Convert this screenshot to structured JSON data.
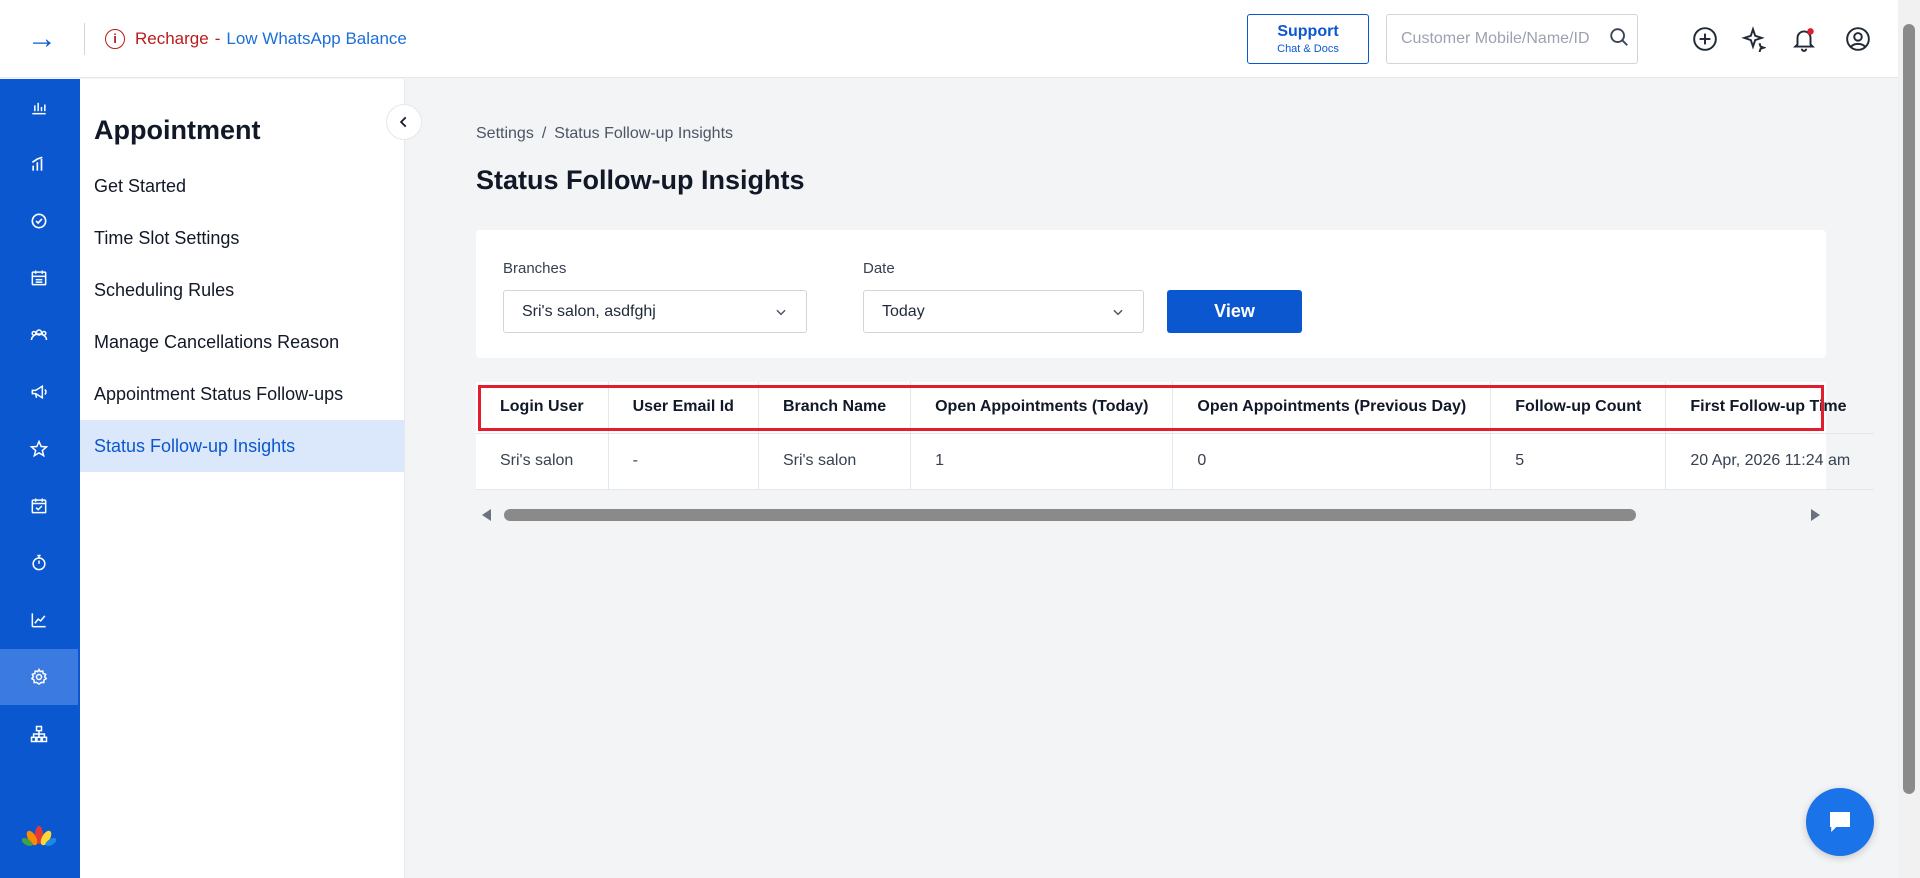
{
  "header": {
    "alert_recharge": "Recharge",
    "alert_separator": "-",
    "alert_low_balance": "Low WhatsApp Balance",
    "support_title": "Support",
    "support_subtitle": "Chat & Docs",
    "search_placeholder": "Customer Mobile/Name/ID"
  },
  "rail": {
    "items": [
      "dashboard-icon",
      "reports-icon",
      "check-circle-icon",
      "calendar-icon",
      "customers-icon",
      "megaphone-icon",
      "star-icon",
      "calendar-check-icon",
      "timer-icon",
      "analytics-icon",
      "settings-icon",
      "organization-icon"
    ],
    "active": "settings-icon"
  },
  "subnav": {
    "title": "Appointment",
    "items": [
      {
        "label": "Get Started"
      },
      {
        "label": "Time Slot Settings"
      },
      {
        "label": "Scheduling Rules"
      },
      {
        "label": "Manage Cancellations Reason"
      },
      {
        "label": "Appointment Status Follow-ups"
      },
      {
        "label": "Status Follow-up Insights",
        "active": true
      }
    ]
  },
  "breadcrumb": {
    "root": "Settings",
    "separator": "/",
    "current": "Status Follow-up Insights"
  },
  "page_title": "Status Follow-up Insights",
  "filters": {
    "branches_label": "Branches",
    "branches_value": "Sri's salon, asdfghj",
    "date_label": "Date",
    "date_value": "Today",
    "view_label": "View"
  },
  "table": {
    "columns": [
      "Login User",
      "User Email Id",
      "Branch Name",
      "Open Appointments (Today)",
      "Open Appointments (Previous Day)",
      "Follow-up Count",
      "First Follow-up Time"
    ],
    "rows": [
      [
        "Sri's salon",
        "-",
        "Sri's salon",
        "1",
        "0",
        "5",
        "20 Apr, 2026 11:24 am"
      ]
    ]
  },
  "colors": {
    "primary": "#0b57d0",
    "highlight": "#e11d2e",
    "alert": "#b91c1c"
  }
}
